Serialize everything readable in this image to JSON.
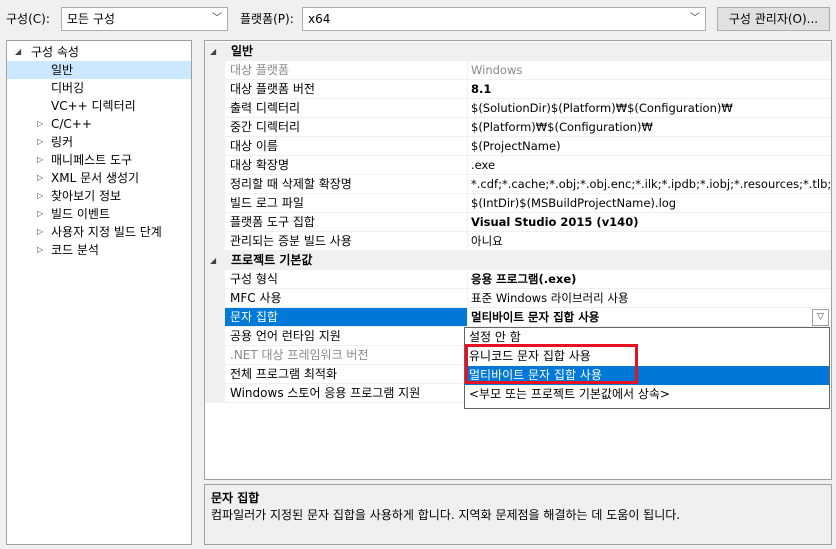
{
  "toolbar": {
    "config_label": "구성(C):",
    "config_value": "모든 구성",
    "platform_label": "플랫폼(P):",
    "platform_value": "x64",
    "config_manager_button": "구성 관리자(O)..."
  },
  "tree": {
    "root": "구성 속성",
    "items": [
      {
        "label": "일반",
        "expandable": false,
        "selected": true
      },
      {
        "label": "디버깅",
        "expandable": false
      },
      {
        "label": "VC++ 디렉터리",
        "expandable": false
      },
      {
        "label": "C/C++",
        "expandable": true
      },
      {
        "label": "링커",
        "expandable": true
      },
      {
        "label": "매니페스트 도구",
        "expandable": true
      },
      {
        "label": "XML 문서 생성기",
        "expandable": true
      },
      {
        "label": "찾아보기 정보",
        "expandable": true
      },
      {
        "label": "빌드 이벤트",
        "expandable": true
      },
      {
        "label": "사용자 지정 빌드 단계",
        "expandable": true
      },
      {
        "label": "코드 분석",
        "expandable": true
      }
    ]
  },
  "grid": {
    "categories": {
      "general": "일반",
      "project_defaults": "프로젝트 기본값"
    },
    "general_rows": [
      {
        "name": "대상 플랫폼",
        "value": "Windows",
        "dim": true
      },
      {
        "name": "대상 플랫폼 버전",
        "value": "8.1",
        "bold": true
      },
      {
        "name": "출력 디렉터리",
        "value": "$(SolutionDir)$(Platform)₩$(Configuration)₩"
      },
      {
        "name": "중간 디렉터리",
        "value": "$(Platform)₩$(Configuration)₩"
      },
      {
        "name": "대상 이름",
        "value": "$(ProjectName)"
      },
      {
        "name": "대상 확장명",
        "value": ".exe"
      },
      {
        "name": "정리할 때 삭제할 확장명",
        "value": "*.cdf;*.cache;*.obj;*.obj.enc;*.ilk;*.ipdb;*.iobj;*.resources;*.tlb;*.tli;*.tl"
      },
      {
        "name": "빌드 로그 파일",
        "value": "$(IntDir)$(MSBuildProjectName).log"
      },
      {
        "name": "플랫폼 도구 집합",
        "value": "Visual Studio 2015 (v140)",
        "bold": true
      },
      {
        "name": "관리되는 증분 빌드 사용",
        "value": "아니요"
      }
    ],
    "default_rows": [
      {
        "name": "구성 형식",
        "value": "응용 프로그램(.exe)",
        "bold": true
      },
      {
        "name": "MFC 사용",
        "value": "표준 Windows 라이브러리 사용"
      },
      {
        "name": "문자 집합",
        "value": "멀티바이트 문자 집합 사용",
        "bold": true,
        "selected": true
      },
      {
        "name": "공용 언어 런타임 지원",
        "value": ""
      },
      {
        "name": ".NET 대상 프레임워크 버전",
        "value": "",
        "dim": true
      },
      {
        "name": "전체 프로그램 최적화",
        "value": ""
      },
      {
        "name": "Windows 스토어 응용 프로그램 지원",
        "value": ""
      }
    ]
  },
  "dropdown": {
    "options": [
      {
        "label": "설정 안 함"
      },
      {
        "label": "유니코드 문자 집합 사용"
      },
      {
        "label": "멀티바이트 문자 집합 사용",
        "selected": true
      },
      {
        "label": "<부모 또는 프로젝트 기본값에서 상속>"
      }
    ]
  },
  "description": {
    "title": "문자 집합",
    "text": "컴파일러가 지정된 문자 집합을 사용하게 합니다. 지역화 문제점을 해결하는 데 도움이 됩니다."
  },
  "colors": {
    "selection": "#0078d7",
    "tree_selection": "#cce8ff",
    "highlight_box": "#e81123"
  }
}
